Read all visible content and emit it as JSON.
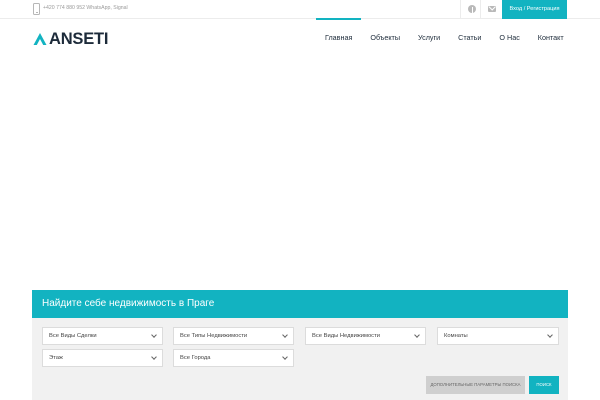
{
  "topbar": {
    "phone_icon": "phone-icon",
    "phone_text": "+420 774 880 952 WhatsApp, Signal",
    "social_icons": [
      "facebook-icon",
      "mail-icon"
    ],
    "login_label": "Вход / Регистрация"
  },
  "header": {
    "logo_text": "ANSETI",
    "nav": [
      {
        "label": "Главная",
        "active": true
      },
      {
        "label": "Объекты"
      },
      {
        "label": "Услуги"
      },
      {
        "label": "Статьи"
      },
      {
        "label": "О Нас"
      },
      {
        "label": "Контакт"
      }
    ]
  },
  "search": {
    "title": "Найдите себе недвижимость в Праге",
    "selects": [
      "Все Виды Сделки",
      "Все Типы Недвижимости",
      "Все Виды Недвижимости",
      "Комнаты",
      "Этаж",
      "Все Города"
    ],
    "advanced_label": "ДОПОЛНИТЕЛЬНЫЕ ПАРАМЕТРЫ ПОИСКА",
    "search_label": "ПОИСК"
  },
  "colors": {
    "accent": "#12b3c1",
    "dark": "#1d2b3a",
    "panel": "#f1f1f1"
  }
}
